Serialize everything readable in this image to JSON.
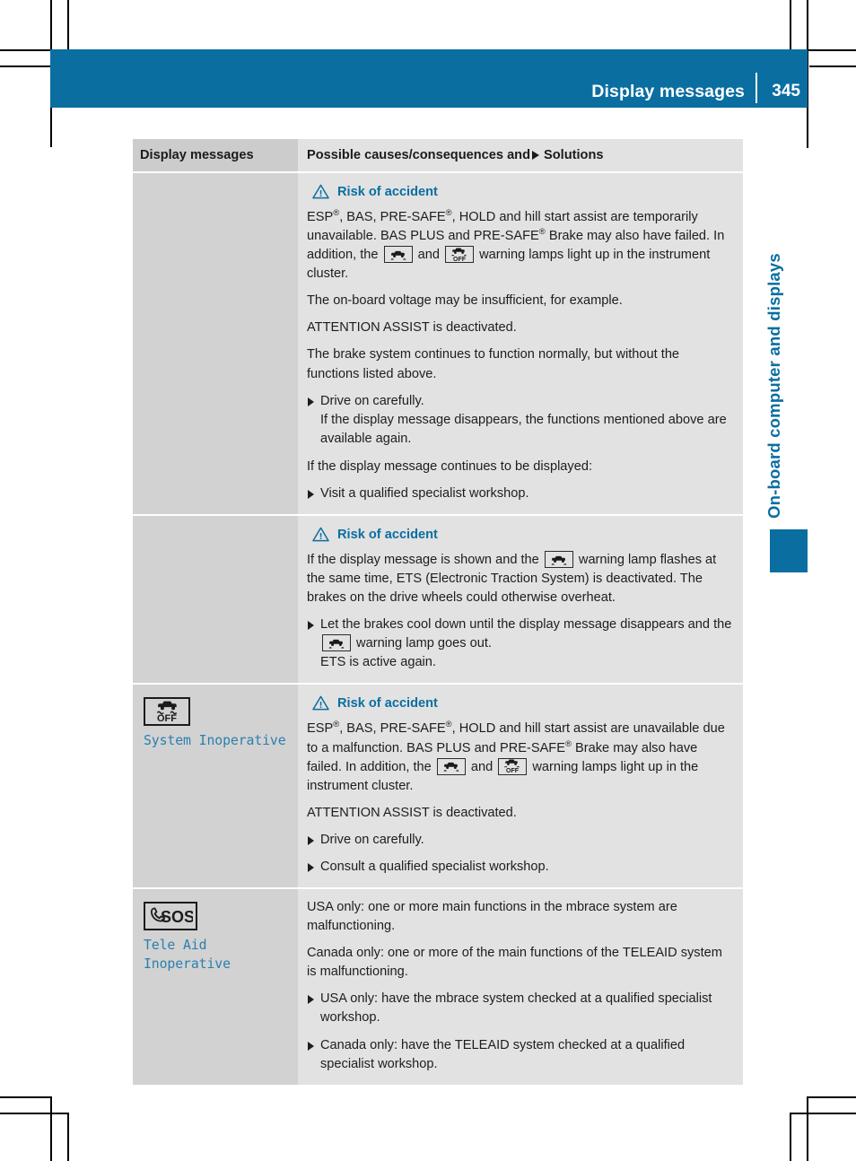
{
  "header": {
    "title": "Display messages",
    "page_number": "345"
  },
  "chapter_tab": {
    "label": "On-board computer and displays",
    "accent_color": "#0a6ea1"
  },
  "table": {
    "columns": {
      "left": "Display messages",
      "right_prefix": "Possible causes/consequences and",
      "right_suffix": "Solutions"
    },
    "rows": [
      {
        "left": {
          "icon": "none",
          "message_lines": []
        },
        "right": {
          "warning_heading": "Risk of accident",
          "paragraphs": [
            "ESP®, BAS, PRE-SAFE®, HOLD and hill start assist are temporarily unavailable. BAS PLUS and PRE-SAFE® Brake may also have failed. In addition, the [esp-lamp] and [esp-off-lamp] warning lamps light up in the instrument cluster.",
            "The on-board voltage may be insufficient, for example.",
            "ATTENTION ASSIST is deactivated.",
            "The brake system continues to function normally, but without the functions listed above."
          ],
          "bullets": [
            "Drive on carefully.\nIf the display message disappears, the functions mentioned above are available again."
          ],
          "trailing_paragraph": "If the display message continues to be displayed:",
          "trailing_bullets": [
            "Visit a qualified specialist workshop."
          ]
        }
      },
      {
        "left": {
          "icon": "none",
          "message_lines": []
        },
        "right": {
          "warning_heading": "Risk of accident",
          "paragraphs": [
            "If the display message is shown and the [esp-lamp] warning lamp flashes at the same time, ETS (Electronic Traction System) is deactivated. The brakes on the drive wheels could otherwise overheat."
          ],
          "bullets": [
            "Let the brakes cool down until the display message disappears and the [esp-lamp] warning lamp goes out.\nETS is active again."
          ]
        }
      },
      {
        "left": {
          "icon": "esp-off-icon",
          "message_lines": [
            "System Inoperative"
          ]
        },
        "right": {
          "warning_heading": "Risk of accident",
          "paragraphs": [
            "ESP®, BAS, PRE-SAFE®, HOLD and hill start assist are unavailable due to a malfunction. BAS PLUS and PRE-SAFE® Brake may also have failed. In addition, the [esp-lamp] and [esp-off-lamp] warning lamps light up in the instrument cluster.",
            "ATTENTION ASSIST is deactivated."
          ],
          "bullets": [
            "Drive on carefully.",
            "Consult a qualified specialist workshop."
          ]
        }
      },
      {
        "left": {
          "icon": "sos-icon",
          "message_lines": [
            "Tele Aid",
            "Inoperative"
          ]
        },
        "right": {
          "warning_heading": "",
          "paragraphs": [
            "USA only: one or more main functions in the mbrace system are malfunctioning.",
            "Canada only: one or more of the main functions of the TELEAID system is malfunctioning."
          ],
          "bullets": [
            "USA only: have the mbrace system checked at a qualified specialist workshop.",
            "Canada only: have the TELEAID system checked at a qualified specialist workshop."
          ]
        }
      }
    ]
  },
  "text": {
    "r1_p1_a": "ESP",
    "r1_p1_b": ", BAS, PRE-SAFE",
    "r1_p1_c": ", HOLD and hill start assist are temporarily unavailable. BAS PLUS and PRE-SAFE",
    "r1_p1_d": " Brake may also have failed. In addition, the ",
    "r1_p1_e": " and ",
    "r1_p1_f": " warning lamps light up in the instrument cluster.",
    "r1_p2": "The on-board voltage may be insufficient, for example.",
    "r1_p3": "ATTENTION ASSIST is deactivated.",
    "r1_p4": "The brake system continues to function normally, but without the functions listed above.",
    "r1_b1_l1": "Drive on carefully.",
    "r1_b1_l2": "If the display message disappears, the functions mentioned above are available again.",
    "r1_p5": "If the display message continues to be displayed:",
    "r1_b2": "Visit a qualified specialist workshop.",
    "r2_p1_a": "If the display message is shown and the ",
    "r2_p1_b": " warning lamp flashes at the same time, ETS (Electronic Traction System) is deactivated. The brakes on the drive wheels could otherwise overheat.",
    "r2_b1_a": "Let the brakes cool down until the display message disappears and the ",
    "r2_b1_b": " warning lamp goes out.",
    "r2_b1_c": "ETS is active again.",
    "r3_msg": "System Inoperative",
    "r3_p1_a": "ESP",
    "r3_p1_b": ", BAS, PRE-SAFE",
    "r3_p1_c": ", HOLD and hill start assist are unavailable due to a malfunction. BAS PLUS and PRE-SAFE",
    "r3_p1_d": " Brake may also have failed. In addition, the ",
    "r3_p1_e": " and ",
    "r3_p1_f": " warning lamps light up in the instrument cluster.",
    "r3_p2": "ATTENTION ASSIST is deactivated.",
    "r3_b1": "Drive on carefully.",
    "r3_b2": "Consult a qualified specialist workshop.",
    "r4_msg_l1": "Tele Aid",
    "r4_msg_l2": "Inoperative",
    "r4_p1": "USA only: one or more main functions in the mbrace system are malfunctioning.",
    "r4_p2": "Canada only: one or more of the main functions of the TELEAID system is malfunctioning.",
    "r4_b1": "USA only: have the mbrace system checked at a qualified specialist workshop.",
    "r4_b2": "Canada only: have the TELEAID system checked at a qualified specialist workshop.",
    "reg_mark": "®",
    "warning_heading": "Risk of accident",
    "sos_label": "SOS",
    "off_label": "OFF"
  }
}
